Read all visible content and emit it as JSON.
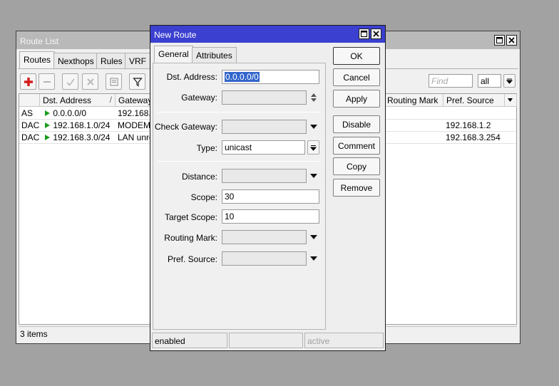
{
  "route_list": {
    "title": "Route List",
    "tabs": [
      "Routes",
      "Nexthops",
      "Rules",
      "VRF"
    ],
    "find_placeholder": "Find",
    "filter_value": "all",
    "columns": {
      "flags": "",
      "dst": "Dst. Address",
      "gateway": "Gateway",
      "routing_mark": "Routing Mark",
      "pref_source": "Pref. Source"
    },
    "rows": [
      {
        "flags": "AS",
        "dst": "0.0.0.0/0",
        "gateway": "192.168.1",
        "pref_source": ""
      },
      {
        "flags": "DAC",
        "dst": "192.168.1.0/24",
        "gateway": "MODEM r",
        "pref_source": "192.168.1.2"
      },
      {
        "flags": "DAC",
        "dst": "192.168.3.0/24",
        "gateway": "LAN unre",
        "pref_source": "192.168.3.254"
      }
    ],
    "item_count": "3 items"
  },
  "new_route": {
    "title": "New Route",
    "tabs": [
      "General",
      "Attributes"
    ],
    "fields": {
      "dst_label": "Dst. Address:",
      "dst_value": "0.0.0.0/0",
      "gateway_label": "Gateway:",
      "check_gateway_label": "Check Gateway:",
      "type_label": "Type:",
      "type_value": "unicast",
      "distance_label": "Distance:",
      "scope_label": "Scope:",
      "scope_value": "30",
      "target_scope_label": "Target Scope:",
      "target_scope_value": "10",
      "routing_mark_label": "Routing Mark:",
      "pref_source_label": "Pref. Source:"
    },
    "buttons": {
      "ok": "OK",
      "cancel": "Cancel",
      "apply": "Apply",
      "disable": "Disable",
      "comment": "Comment",
      "copy": "Copy",
      "remove": "Remove"
    },
    "status": {
      "left": "enabled",
      "middle": "",
      "right": "active"
    }
  }
}
